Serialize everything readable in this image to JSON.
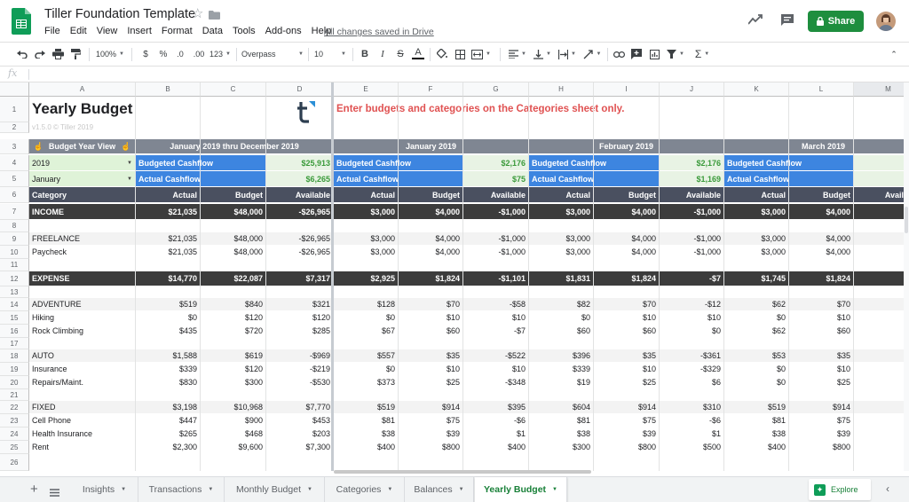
{
  "app": {
    "doc_title": "Tiller Foundation Template",
    "menu": [
      "File",
      "Edit",
      "View",
      "Insert",
      "Format",
      "Data",
      "Tools",
      "Add-ons",
      "Help"
    ],
    "save_status": "All changes saved in Drive",
    "share_label": "Share",
    "brand_color": "#1e8e3e"
  },
  "toolbar": {
    "zoom": "100%",
    "currency": "$",
    "percent": "%",
    "decrease_decimal": ".0",
    "increase_decimal": ".00",
    "more_formats": "123",
    "font": "Overpass",
    "font_size": "10",
    "bold": "B",
    "italic": "I",
    "strike": "S",
    "text_color": "A"
  },
  "formula_bar": {
    "fx": "fx",
    "value": ""
  },
  "columns": [
    "A",
    "B",
    "C",
    "D",
    "E",
    "F",
    "G",
    "H",
    "I",
    "J",
    "K",
    "L",
    "M"
  ],
  "rows": [
    "1",
    "2",
    "3",
    "4",
    "5",
    "6",
    "7",
    "8",
    "9",
    "10",
    "11",
    "12",
    "13",
    "14",
    "15",
    "16",
    "17",
    "18",
    "19",
    "20",
    "21",
    "22",
    "23",
    "24",
    "25",
    "26"
  ],
  "sheet": {
    "title": "Yearly Budget",
    "version": "v1.5.0 © Tiller 2019",
    "notice": "Enter budgets and categories on the Categories sheet only.",
    "notice_color": "#e05252",
    "year_view_label": "Budget Year View",
    "year_value": "2019",
    "month_value": "January",
    "periods": [
      "January 2019 thru December 2019",
      "January 2019",
      "February 2019",
      "March 2019"
    ],
    "budgeted_cashflow_label": "Budgeted Cashflow",
    "actual_cashflow_label": "Actual Cashflow",
    "budgeted_cashflow_values": [
      "$25,913",
      "$2,176",
      "$2,176",
      "$2,"
    ],
    "actual_cashflow_values": [
      "$6,265",
      "$75",
      "$1,169",
      "$1,3"
    ],
    "headers": {
      "category": "Category",
      "actual": "Actual",
      "budget": "Budget",
      "available": "Available"
    },
    "lines": [
      {
        "row": 7,
        "kind": "section",
        "label": "INCOME",
        "values": [
          "$21,035",
          "$48,000",
          "-$26,965",
          "$3,000",
          "$4,000",
          "-$1,000",
          "$3,000",
          "$4,000",
          "-$1,000",
          "$3,000",
          "$4,000",
          "-$1,"
        ]
      },
      {
        "row": 9,
        "kind": "group",
        "label": "FREELANCE",
        "values": [
          "$21,035",
          "$48,000",
          "-$26,965",
          "$3,000",
          "$4,000",
          "-$1,000",
          "$3,000",
          "$4,000",
          "-$1,000",
          "$3,000",
          "$4,000",
          "-$1,"
        ]
      },
      {
        "row": 10,
        "kind": "item",
        "label": "Paycheck",
        "values": [
          "$21,035",
          "$48,000",
          "-$26,965",
          "$3,000",
          "$4,000",
          "-$1,000",
          "$3,000",
          "$4,000",
          "-$1,000",
          "$3,000",
          "$4,000",
          "-$1,"
        ]
      },
      {
        "row": 12,
        "kind": "section",
        "label": "EXPENSE",
        "values": [
          "$14,770",
          "$22,087",
          "$7,317",
          "$2,925",
          "$1,824",
          "-$1,101",
          "$1,831",
          "$1,824",
          "-$7",
          "$1,745",
          "$1,824",
          ""
        ]
      },
      {
        "row": 14,
        "kind": "group",
        "label": "ADVENTURE",
        "values": [
          "$519",
          "$840",
          "$321",
          "$128",
          "$70",
          "-$58",
          "$82",
          "$70",
          "-$12",
          "$62",
          "$70",
          ""
        ]
      },
      {
        "row": 15,
        "kind": "item",
        "label": "Hiking",
        "values": [
          "$0",
          "$120",
          "$120",
          "$0",
          "$10",
          "$10",
          "$0",
          "$10",
          "$10",
          "$0",
          "$10",
          ""
        ]
      },
      {
        "row": 16,
        "kind": "item",
        "label": "Rock Climbing",
        "values": [
          "$435",
          "$720",
          "$285",
          "$67",
          "$60",
          "-$7",
          "$60",
          "$60",
          "$0",
          "$62",
          "$60",
          ""
        ]
      },
      {
        "row": 18,
        "kind": "group",
        "label": "AUTO",
        "values": [
          "$1,588",
          "$619",
          "-$969",
          "$557",
          "$35",
          "-$522",
          "$396",
          "$35",
          "-$361",
          "$53",
          "$35",
          ""
        ]
      },
      {
        "row": 19,
        "kind": "item",
        "label": "Insurance",
        "values": [
          "$339",
          "$120",
          "-$219",
          "$0",
          "$10",
          "$10",
          "$339",
          "$10",
          "-$329",
          "$0",
          "$10",
          ""
        ]
      },
      {
        "row": 20,
        "kind": "item",
        "label": "Repairs/Maint.",
        "values": [
          "$830",
          "$300",
          "-$530",
          "$373",
          "$25",
          "-$348",
          "$19",
          "$25",
          "$6",
          "$0",
          "$25",
          ""
        ]
      },
      {
        "row": 22,
        "kind": "group",
        "label": "FIXED",
        "values": [
          "$3,198",
          "$10,968",
          "$7,770",
          "$519",
          "$914",
          "$395",
          "$604",
          "$914",
          "$310",
          "$519",
          "$914",
          ""
        ]
      },
      {
        "row": 23,
        "kind": "item",
        "label": "Cell Phone",
        "values": [
          "$447",
          "$900",
          "$453",
          "$81",
          "$75",
          "-$6",
          "$81",
          "$75",
          "-$6",
          "$81",
          "$75",
          ""
        ]
      },
      {
        "row": 24,
        "kind": "item",
        "label": "Health Insurance",
        "values": [
          "$265",
          "$468",
          "$203",
          "$38",
          "$39",
          "$1",
          "$38",
          "$39",
          "$1",
          "$38",
          "$39",
          ""
        ]
      },
      {
        "row": 25,
        "kind": "item",
        "label": "Rent",
        "values": [
          "$2,300",
          "$9,600",
          "$7,300",
          "$400",
          "$800",
          "$400",
          "$300",
          "$800",
          "$500",
          "$400",
          "$800",
          ""
        ]
      }
    ],
    "colors": {
      "section_bg": "#3c3c3c",
      "period_bg": "#7f8692",
      "cashflow_blue": "#3d85e0",
      "cashflow_value_bg": "#e8f3e4",
      "cashflow_value_text": "#3a9a3a",
      "header_bg": "#4a5060",
      "selector_bg": "#dff3d8",
      "group_bg": "#f3f3f3"
    }
  },
  "tabs": [
    "Insights",
    "Transactions",
    "Monthly Budget",
    "Categories",
    "Balances",
    "Yearly Budget"
  ],
  "active_tab": "Yearly Budget",
  "explore_label": "Explore"
}
